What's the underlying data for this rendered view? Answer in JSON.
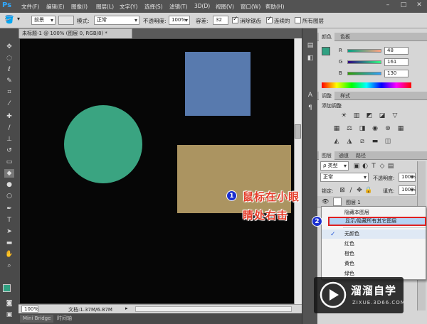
{
  "app": {
    "logo": "Ps"
  },
  "menu": [
    "文件(F)",
    "编辑(E)",
    "图像(I)",
    "图层(L)",
    "文字(Y)",
    "选择(S)",
    "滤镜(T)",
    "3D(D)",
    "视图(V)",
    "窗口(W)",
    "帮助(H)"
  ],
  "options": {
    "mode_preset": "前景",
    "mode_label": "模式:",
    "mode_value": "正常",
    "opacity_label": "不透明度:",
    "opacity_value": "100%",
    "tolerance_label": "容差:",
    "tolerance_value": "32",
    "antialias_label": "消除锯齿",
    "contiguous_label": "连续的",
    "all_layers_label": "所有图层"
  },
  "document": {
    "tab_title": "未标题-1 @ 100% (图层 0, RGB/8) *",
    "shapes": [
      {
        "kind": "rect",
        "color": "#587aae"
      },
      {
        "kind": "circle",
        "color": "#3aa481"
      },
      {
        "kind": "rect",
        "color": "#ab9461"
      }
    ]
  },
  "status": {
    "zoom": "100%",
    "doc_size": "文档:1.37M/6.87M"
  },
  "bottom_tabs": [
    "Mini Bridge",
    "时间轴"
  ],
  "color_panel": {
    "tabs": [
      "颜色",
      "色板"
    ],
    "r": "48",
    "g": "161",
    "b": "130",
    "fg_color": "#30a182"
  },
  "adjust_panel": {
    "tabs": [
      "调整",
      "样式"
    ],
    "title": "添加调整"
  },
  "layers_panel": {
    "tabs": [
      "图层",
      "通道",
      "路径"
    ],
    "filter_label": "ρ 类型",
    "blend_mode": "正常",
    "opacity_label": "不透明度:",
    "opacity_value": "100%",
    "lock_label": "锁定:",
    "fill_label": "填充:",
    "fill_value": "100%",
    "layer_name": "图层 1"
  },
  "context_menu": {
    "items": [
      "隐藏本图层",
      "显示/隐藏所有其它图层",
      "无颜色",
      "红色",
      "橙色",
      "黄色",
      "绿色"
    ]
  },
  "annotations": {
    "badge1": "1",
    "badge2": "2",
    "text_line1": "鼠标在小眼",
    "text_line2": "睛处右击"
  },
  "watermark": {
    "title": "溜溜自学",
    "url": "ZIXUE.3D66.COM"
  }
}
